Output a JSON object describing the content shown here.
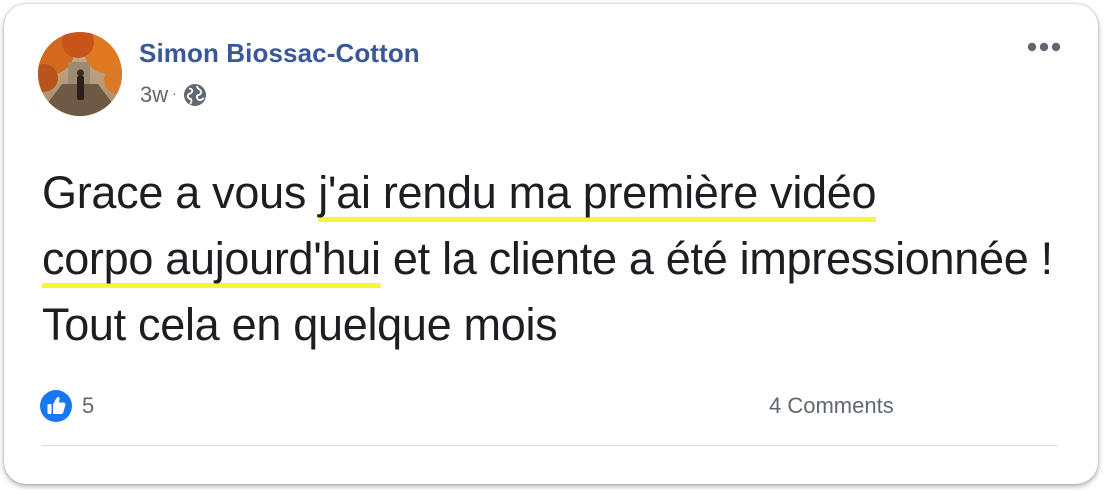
{
  "post": {
    "author": "Simon Biossac-Cotton",
    "timestamp": "3w",
    "separator": "·",
    "privacy_icon": "globe-icon",
    "more_icon": "more-options-icon",
    "text": {
      "before": "Grace a vous ",
      "highlight1": "j'ai rendu ma première vidéo",
      "highlight2": "corpo aujourd'hui",
      "after": " et la cliente a été impressionnée ! Tout cela en quelque mois"
    },
    "highlight_color": "#f5f53b"
  },
  "engagement": {
    "reaction_icon": "like-icon",
    "reaction_count": "5",
    "comments": "4 Comments"
  },
  "colors": {
    "author": "#385898",
    "meta": "#606770",
    "text": "#1c1e21",
    "like": "#1877f2",
    "divider": "#dadde1"
  }
}
